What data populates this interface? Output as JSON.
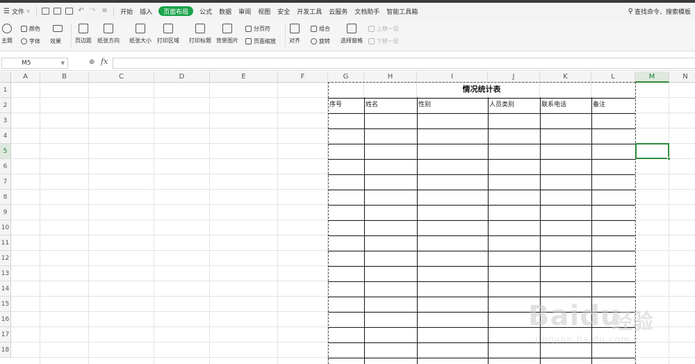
{
  "menubar": {
    "file": "文件",
    "tabs": [
      "开始",
      "插入",
      "页面布局",
      "公式",
      "数据",
      "审阅",
      "视图",
      "安全",
      "开发工具",
      "云服务",
      "文档助手",
      "智能工具箱"
    ],
    "active_tab": "页面布局",
    "search": "查找命令、搜索模板"
  },
  "ribbon": {
    "theme": "主题",
    "colors": "颜色",
    "fonts": "字体",
    "effects": "效果",
    "margins": "页边距",
    "orientation": "纸张方向",
    "size": "纸张大小",
    "print_area": "打印区域",
    "print_titles": "打印标题",
    "background": "背景图片",
    "page_break": "分页符",
    "page_zoom": "页面缩放",
    "align": "对齐",
    "group": "组合",
    "rotate": "旋转",
    "selection_pane": "选择窗格",
    "bring_forward": "上移一层",
    "send_backward": "下移一层"
  },
  "formula_bar": {
    "name_box": "M5",
    "fx": "fx",
    "formula": ""
  },
  "columns": [
    "A",
    "B",
    "C",
    "D",
    "E",
    "F",
    "G",
    "H",
    "I",
    "J",
    "K",
    "L",
    "M",
    "N"
  ],
  "selected_column": "M",
  "rows": [
    "1",
    "2",
    "3",
    "4",
    "5",
    "6",
    "7",
    "8",
    "9",
    "10",
    "11",
    "12",
    "13",
    "14",
    "15",
    "16",
    "17",
    "18"
  ],
  "selected_row": "5",
  "table": {
    "title": "情况统计表",
    "headers": [
      "序号",
      "姓名",
      "性别",
      "人员类别",
      "联系电话",
      "备注"
    ]
  },
  "watermark": {
    "main": "Baidu",
    "cn": "经验",
    "url": "jingyan.baidu.com"
  },
  "colors": {
    "accent": "#1aa34a",
    "selection": "#2e8b3a"
  }
}
